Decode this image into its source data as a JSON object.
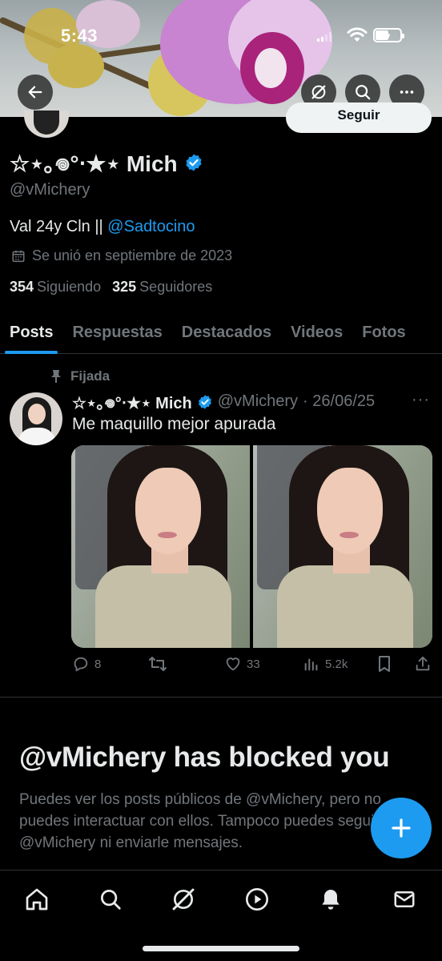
{
  "status_bar": {
    "time": "5:43"
  },
  "header": {
    "follow_label": "Seguir"
  },
  "profile": {
    "display_name": "☆⋆｡𖦹°‧★⋆ Mich",
    "handle": "@vMichery",
    "bio_text": "Val 24y Cln || ",
    "bio_mention": "@Sadtocino",
    "joined": "Se unió en septiembre de 2023",
    "following_count": "354",
    "following_label": "Siguiendo",
    "followers_count": "325",
    "followers_label": "Seguidores"
  },
  "tabs": [
    {
      "label": "Posts",
      "active": true
    },
    {
      "label": "Respuestas",
      "active": false
    },
    {
      "label": "Destacados",
      "active": false
    },
    {
      "label": "Videos",
      "active": false
    },
    {
      "label": "Fotos",
      "active": false
    }
  ],
  "pinned_post": {
    "pinned_label": "Fijada",
    "author_name": "☆⋆｡𖦹°‧★⋆ Mich",
    "author_handle": "@vMichery",
    "date": "· 26/06/25",
    "more": "···",
    "text": "Me maquillo mejor apurada",
    "replies": "8",
    "reposts": "",
    "likes": "33",
    "views": "5.2k"
  },
  "blocked": {
    "title": "@vMichery has blocked you",
    "description": "Puedes ver los posts públicos de @vMichery, pero no puedes interactuar con ellos. Tampoco puedes seguir a @vMichery ni enviarle mensajes."
  },
  "colors": {
    "accent": "#1d9bf0",
    "background": "#000000",
    "text_primary": "#e7e9ea",
    "text_secondary": "#71767b",
    "divider": "#2f3336"
  },
  "icons": {
    "back": "arrow-left-icon",
    "grok": "grok-icon",
    "search": "search-icon",
    "more": "more-icon",
    "verified": "verified-badge-icon",
    "calendar": "calendar-icon",
    "pin": "pin-icon",
    "reply": "reply-icon",
    "repost": "repost-icon",
    "like": "heart-icon",
    "views": "views-icon",
    "bookmark": "bookmark-icon",
    "share": "share-icon",
    "compose": "plus-icon",
    "nav_home": "home-icon",
    "nav_search": "search-icon",
    "nav_grok": "grok-icon",
    "nav_video": "play-icon",
    "nav_notifications": "bell-icon",
    "nav_messages": "mail-icon"
  }
}
